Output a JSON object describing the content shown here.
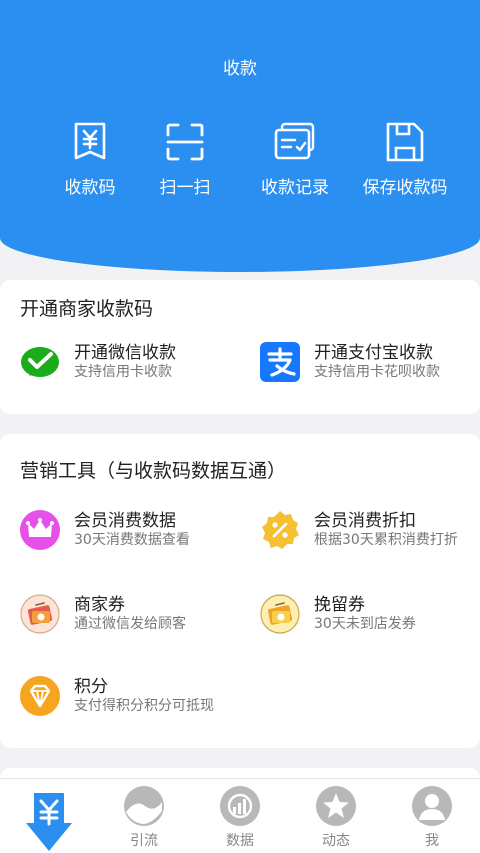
{
  "header": {
    "title": "收款",
    "actions": [
      {
        "label": "收款码",
        "icon": "yuan-card-icon"
      },
      {
        "label": "扫一扫",
        "icon": "scan-icon"
      },
      {
        "label": "收款记录",
        "icon": "records-icon"
      },
      {
        "label": "保存收款码",
        "icon": "save-icon"
      }
    ]
  },
  "open_section": {
    "title": "开通商家收款码",
    "items": [
      {
        "title": "开通微信收款",
        "subtitle": "支持信用卡收款",
        "icon": "wechat-pay-icon"
      },
      {
        "title": "开通支付宝收款",
        "subtitle": "支持信用卡花呗收款",
        "icon": "alipay-icon"
      }
    ]
  },
  "marketing_section": {
    "title": "营销工具（与收款码数据互通）",
    "items": [
      {
        "title": "会员消费数据",
        "subtitle": "30天消费数据查看",
        "icon": "crown-icon"
      },
      {
        "title": "会员消费折扣",
        "subtitle": "根据30天累积消费打折",
        "icon": "discount-badge-icon"
      },
      {
        "title": "商家券",
        "subtitle": "通过微信发给顾客",
        "icon": "merchant-coupon-icon"
      },
      {
        "title": "挽留券",
        "subtitle": "30天未到店发券",
        "icon": "retention-coupon-icon"
      },
      {
        "title": "积分",
        "subtitle": "支付得积分积分可抵现",
        "icon": "points-gem-icon"
      }
    ]
  },
  "tabbar": {
    "tabs": [
      {
        "label": "",
        "icon": "yuan-download-icon",
        "active": true
      },
      {
        "label": "引流",
        "icon": "traffic-icon"
      },
      {
        "label": "数据",
        "icon": "data-chart-icon"
      },
      {
        "label": "动态",
        "icon": "star-icon"
      },
      {
        "label": "我",
        "icon": "user-icon"
      }
    ]
  },
  "colors": {
    "primary_blue": "#2a8ff0",
    "wechat_green": "#1aad19",
    "alipay_blue": "#1678ff",
    "tab_gray": "#b8b8b8"
  }
}
